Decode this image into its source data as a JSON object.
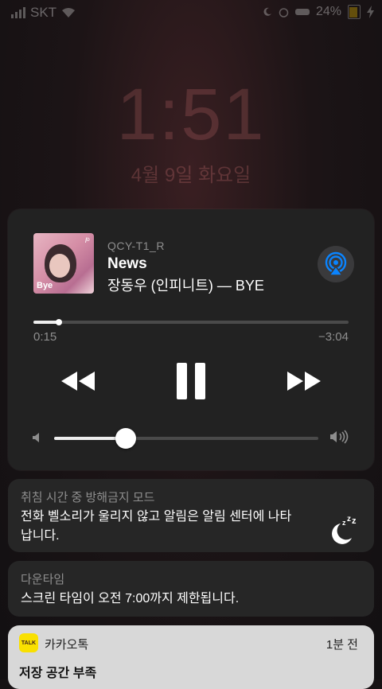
{
  "status_bar": {
    "carrier": "SKT",
    "battery_percent": "24%"
  },
  "lock_screen": {
    "time": "1:51",
    "date": "4월 9일 화요일"
  },
  "player": {
    "device": "QCY-T1_R",
    "title": "News",
    "subtitle": "장동우 (인피니트) — BYE",
    "album_art_text": "Bye",
    "elapsed": "0:15",
    "remaining": "−3:04",
    "progress_fraction": 0.08,
    "volume_fraction": 0.27
  },
  "notifications": [
    {
      "header": "취침 시간 중 방해금지 모드",
      "body": "전화 벨소리가 울리지 않고 알림은 알림 센터에 나타납니다."
    },
    {
      "header": "다운타임",
      "body": "스크린 타임이 오전 7:00까지 제한됩니다."
    },
    {
      "app": "카카오톡",
      "icon_label": "TALK",
      "time": "1분 전",
      "title": "저장 공간 부족"
    }
  ],
  "colors": {
    "accent": "#0a84ff",
    "kakao_yellow": "#f9e000",
    "battery": "#f2c000"
  }
}
